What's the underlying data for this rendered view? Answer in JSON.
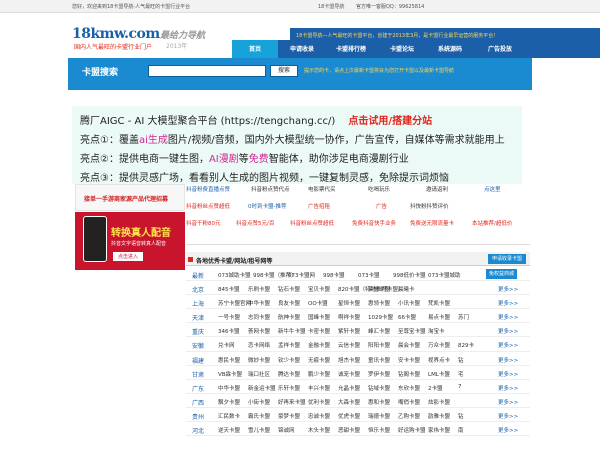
{
  "topbar": {
    "welcome": "您好，欢迎来到18卡盟导航-人气最旺的卡盟行业平台",
    "site_name": "18卡盟导航",
    "qq": "官方唯一客服QQ：99625814"
  },
  "header": {
    "logo": "18kmw.com",
    "logo_sub": "国内人气最旺的卡盟行业门户",
    "slogan": "最给力导航",
    "slogan_year": "2013年",
    "notice": "18卡盟导航—人气最旺的卡盟平台，创建于2013年3月，是卡盟行业最早运营的服务平台！"
  },
  "nav": {
    "items": [
      "首页",
      "申请收录",
      "卡盟排行榜",
      "卡盟论坛",
      "系统源码",
      "广告投放"
    ]
  },
  "search": {
    "label": "卡盟搜索",
    "placeholder": "",
    "button": "搜索",
    "tip": "提示您的卡，请点上次最新卡盟将会为您打开卡盟以及最新卡盟导航"
  },
  "ad": {
    "line1_prefix": "腾厂AIGC - AI 大模型聚合平台 (https://tengchang.cc/)",
    "line1_cta": "点击试用/搭建分站",
    "line2_a": "亮点①：覆盖",
    "line2_ai": "ai生成",
    "line2_b": "图片/视频/音频，国内外大模型统一协作，广告宣传，自媒体等需求就能用上",
    "line3_a": "亮点②：提供电商一键生图，",
    "line3_ai": "AI漫剧",
    "line3_b": "等",
    "line3_free": "免费",
    "line3_c": "智能体，助你涉足电商漫剧行业",
    "line4": "亮点③：提供灵感广场，看看别人生成的图片视频，一键复制灵感，免除提示词烦恼"
  },
  "left_ads": {
    "banner1": "接单一手游商家源产品代理招募",
    "phone_title": "转换真人配音",
    "phone_sub": "抖音文字语音转真人配音",
    "phone_btn": "点击进入"
  },
  "links": {
    "row1": [
      "抖音粉费直播点赞",
      "抖音粉点赞代点",
      "电影票代买",
      "吃喝玩乐",
      "邀请返利",
      "点这里"
    ],
    "row2": [
      "抖音粉丝点赞超低",
      "0时到卡盟-推荐",
      "广告招租",
      "广告",
      "抖快粉抖赞评价"
    ],
    "row3": [
      "抖音千粉80元",
      "抖音点赞5元/百",
      "抖音粉丝点赞超低",
      "免费抖音快手业务",
      "免费送无限流量卡",
      "本站推荐/超低价"
    ]
  },
  "section": {
    "title": "各地优秀卡盟/网站/租号网等",
    "apply": "申请收录卡盟"
  },
  "table": [
    {
      "region": "最新",
      "items": [
        "073城助卡盟",
        "998卡盟（推荐）",
        "073卡盟网",
        "998卡盟",
        "073卡盟",
        "998低价卡盟",
        "073卡盟城助",
        "免权益商城"
      ],
      "badge": true
    },
    {
      "region": "北京",
      "items": [
        "845卡盟",
        "乐刷卡盟",
        "钻石卡盟",
        "宝贝卡盟",
        "820卡盟（特地推荐卡盟）",
        "荣誉卡盟",
        "晨曦卡"
      ],
      "more": "更多>>"
    },
    {
      "region": "上海",
      "items": [
        "苏宁卡盟官网",
        "中华卡盟",
        "良友卡盟",
        "OO卡盟",
        "星恒卡盟",
        "惠领卡盟",
        "小讯卡盟",
        "梵凯卡盟"
      ],
      "more": "更多>>"
    },
    {
      "region": "天津",
      "items": [
        "一号卡盟",
        "志同卡盟",
        "航神卡盟",
        "国峰卡盟",
        "啊祥卡盟",
        "1029卡盟",
        "66卡盟",
        "易点卡盟",
        "苏门"
      ],
      "more": "更多>>"
    },
    {
      "region": "重庆",
      "items": [
        "346卡盟",
        "荟网卡盟",
        "新牛牛卡盟",
        "卡密卡盟",
        "紫轩卡盟",
        "峰汇卡盟",
        "至尊宝卡盟",
        "淘宝卡"
      ],
      "more": "更多>>"
    },
    {
      "region": "安徽",
      "items": [
        "兑卡网",
        "恋卡网络",
        "孟祥卡盟",
        "金融卡盟",
        "云信卡盟",
        "阳阳卡盟",
        "晨会卡盟",
        "万众卡盟",
        "829卡"
      ],
      "more": "更多>>"
    },
    {
      "region": "福建",
      "items": [
        "惠民卡盟",
        "微妙卡盟",
        "钦少卡盟",
        "无痕卡盟",
        "旭杰卡盟",
        "童讯卡盟",
        "安卡卡盟",
        "视界点卡",
        "钻"
      ],
      "more": "更多>>"
    },
    {
      "region": "甘肃",
      "items": [
        "VB霖卡盟",
        "瑞口社区",
        "腾达卡盟",
        "鹏少卡盟",
        "诚宠卡盟",
        "罗伊卡盟",
        "钻阁卡盟",
        "LML卡盟",
        "宅"
      ],
      "more": "更多>>"
    },
    {
      "region": "广东",
      "items": [
        "中华卡盟",
        "新金运卡盟",
        "乐轩卡盟",
        "丰兴卡盟",
        "允晶卡盟",
        "钻域卡盟",
        "东欣卡盟",
        "2卡盟",
        "7"
      ],
      "more": "更多>>"
    },
    {
      "region": "广西",
      "items": [
        "飘夕卡盟",
        "小街卡盟",
        "好再来卡盟",
        "优利卡盟",
        "大森卡盟",
        "惠和卡盟",
        "嘴俏卡盟",
        "炫影卡盟"
      ],
      "more": "更多>>"
    },
    {
      "region": "贵州",
      "items": [
        "汇民数卡",
        "霸氏卡盟",
        "豪梦卡盟",
        "忠诚卡盟",
        "优虎卡盟",
        "瑞德卡盟",
        "乙购卡盟",
        "韵雅卡盟",
        "钻"
      ],
      "more": "更多>>"
    },
    {
      "region": "河北",
      "items": [
        "逆天卡盟",
        "雪儿卡盟",
        "锦诚网",
        "木头卡盟",
        "恶甜卡盟",
        "恒乐卡盟",
        "好运购卡盟",
        "家伟卡盟",
        "南"
      ],
      "more": "更多>>"
    }
  ]
}
